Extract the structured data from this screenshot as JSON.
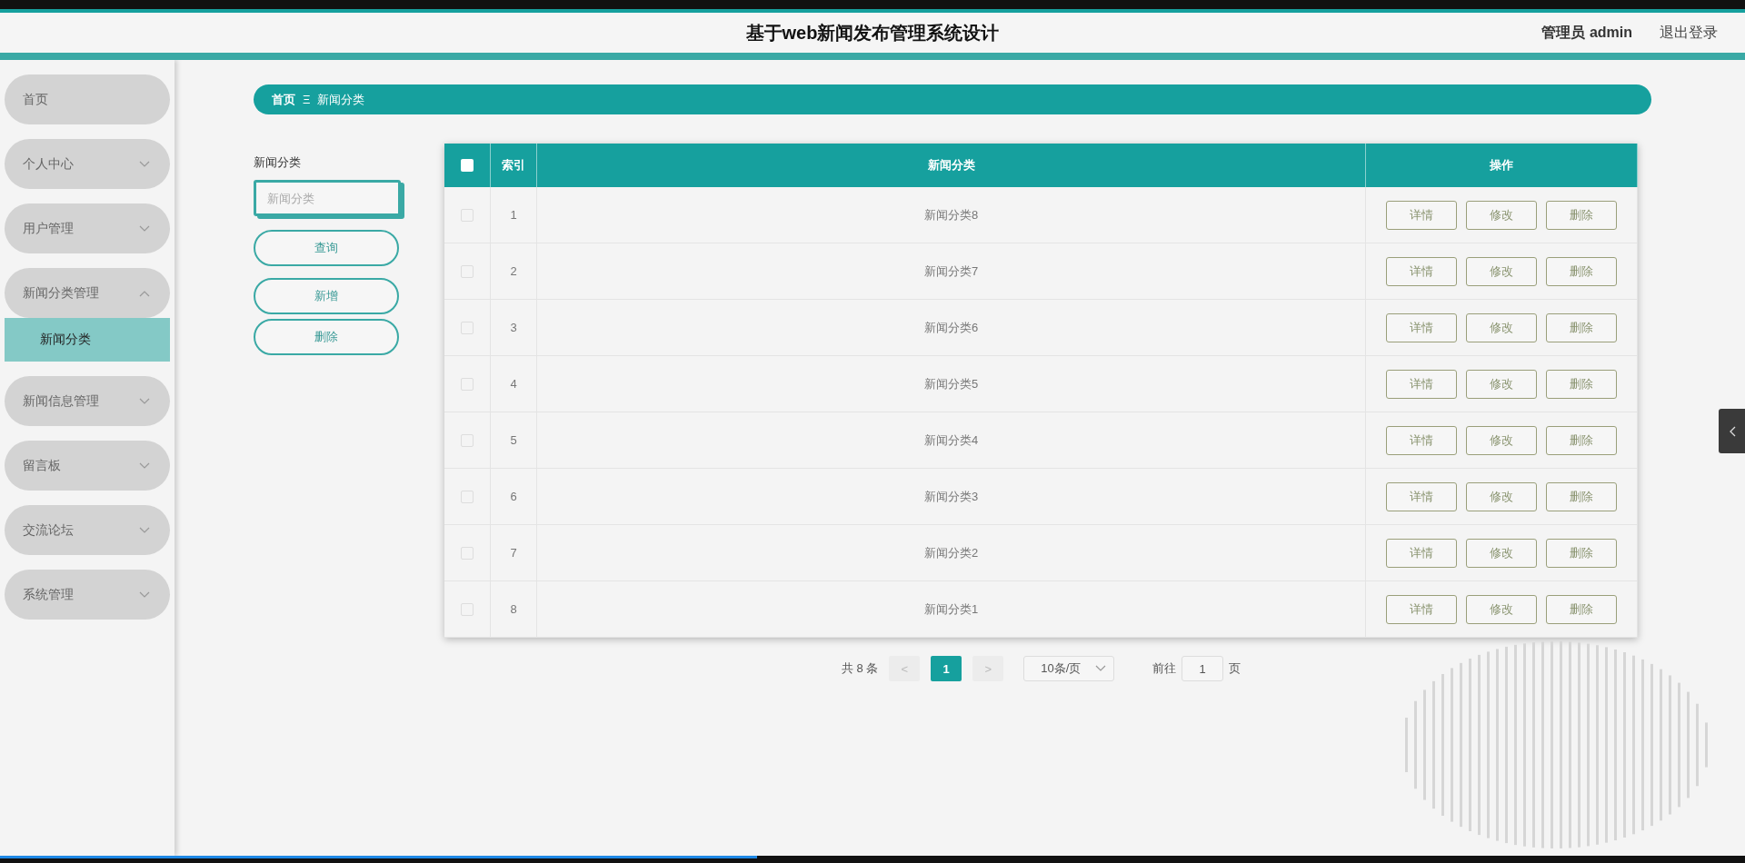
{
  "header": {
    "title": "基于web新闻发布管理系统设计",
    "user": "管理员 admin",
    "logout": "退出登录"
  },
  "sidebar": {
    "items": [
      {
        "kind": "link",
        "label": "首页"
      },
      {
        "kind": "menu",
        "label": "个人中心",
        "expanded": false
      },
      {
        "kind": "menu",
        "label": "用户管理",
        "expanded": false
      },
      {
        "kind": "menu",
        "label": "新闻分类管理",
        "expanded": true,
        "children": [
          {
            "label": "新闻分类",
            "selected": true
          }
        ]
      },
      {
        "kind": "menu",
        "label": "新闻信息管理",
        "expanded": false
      },
      {
        "kind": "menu",
        "label": "留言板",
        "expanded": false
      },
      {
        "kind": "menu",
        "label": "交流论坛",
        "expanded": false
      },
      {
        "kind": "menu",
        "label": "系统管理",
        "expanded": false
      }
    ]
  },
  "breadcrumb": {
    "items": [
      "首页",
      "新闻分类"
    ],
    "separator": "Ξ"
  },
  "search": {
    "label": "新闻分类",
    "placeholder": "新闻分类",
    "buttons": [
      "查询",
      "新增",
      "删除"
    ]
  },
  "table": {
    "header_checked": false,
    "columns": [
      "索引",
      "新闻分类",
      "操作"
    ],
    "rows": [
      {
        "checked": false,
        "index": "1",
        "name": "新闻分类8",
        "actions": [
          "详情",
          "修改",
          "删除"
        ]
      },
      {
        "checked": false,
        "index": "2",
        "name": "新闻分类7",
        "actions": [
          "详情",
          "修改",
          "删除"
        ]
      },
      {
        "checked": false,
        "index": "3",
        "name": "新闻分类6",
        "actions": [
          "详情",
          "修改",
          "删除"
        ]
      },
      {
        "checked": false,
        "index": "4",
        "name": "新闻分类5",
        "actions": [
          "详情",
          "修改",
          "删除"
        ]
      },
      {
        "checked": false,
        "index": "5",
        "name": "新闻分类4",
        "actions": [
          "详情",
          "修改",
          "删除"
        ]
      },
      {
        "checked": false,
        "index": "6",
        "name": "新闻分类3",
        "actions": [
          "详情",
          "修改",
          "删除"
        ]
      },
      {
        "checked": false,
        "index": "7",
        "name": "新闻分类2",
        "actions": [
          "详情",
          "修改",
          "删除"
        ]
      },
      {
        "checked": false,
        "index": "8",
        "name": "新闻分类1",
        "actions": [
          "详情",
          "修改",
          "删除"
        ]
      }
    ]
  },
  "pagination": {
    "total": "共 8 条",
    "prev": "<",
    "pages": [
      {
        "label": "1",
        "selected": true
      }
    ],
    "next": ">",
    "page_size": "10条/页",
    "goto_label": "前往",
    "goto_value": "1",
    "goto_suffix": "页"
  },
  "video_bar": {
    "level": 0.434
  }
}
